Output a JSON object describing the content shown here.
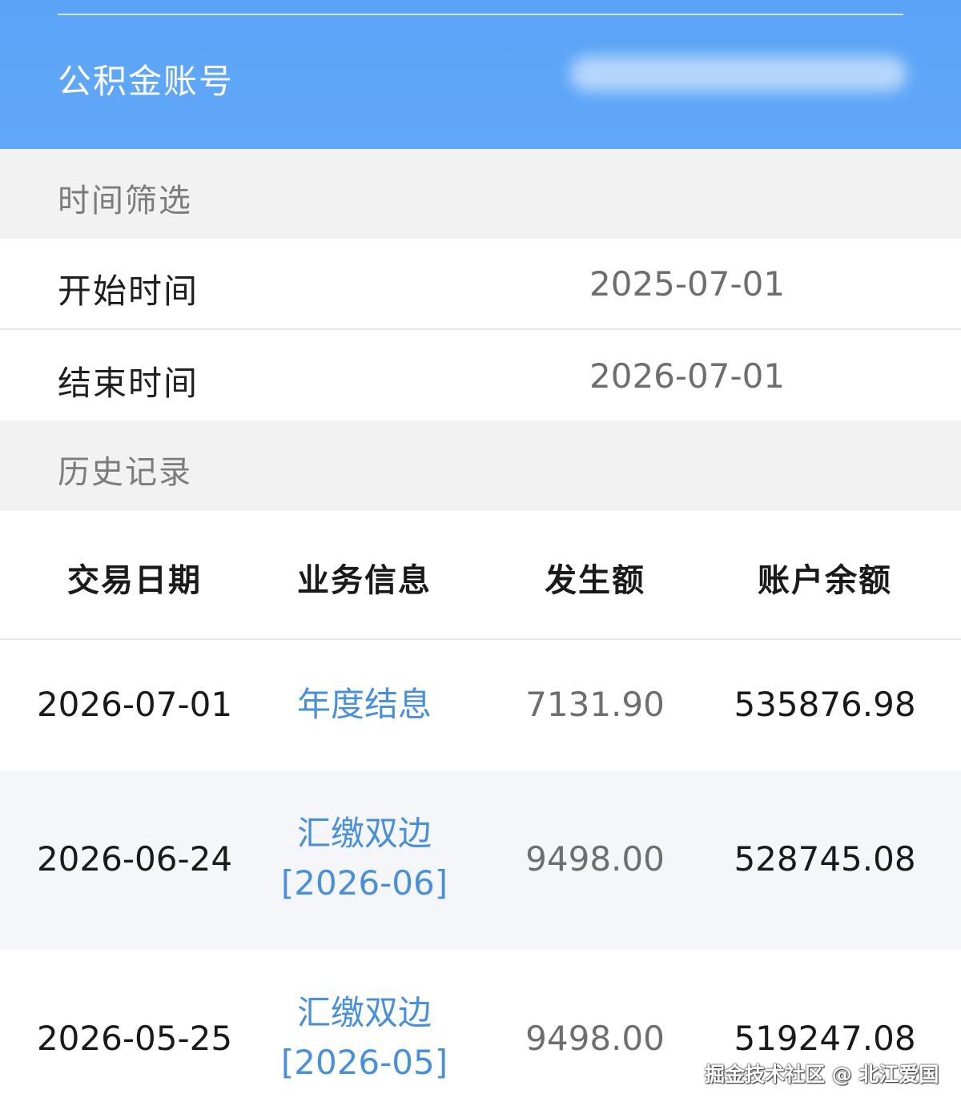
{
  "header": {
    "account_label": "公积金账号"
  },
  "filter_section": {
    "title": "时间筛选",
    "start_label": "开始时间",
    "start_value": "2025-07-01",
    "end_label": "结束时间",
    "end_value": "2026-07-01"
  },
  "history_section": {
    "title": "历史记录",
    "columns": [
      "交易日期",
      "业务信息",
      "发生额",
      "账户余额"
    ],
    "rows": [
      {
        "date": "2026-07-01",
        "info_line1": "年度结息",
        "info_line2": "",
        "amount": "7131.90",
        "balance": "535876.98"
      },
      {
        "date": "2026-06-24",
        "info_line1": "汇缴双边",
        "info_line2": "[2026-06]",
        "amount": "9498.00",
        "balance": "528745.08"
      },
      {
        "date": "2026-05-25",
        "info_line1": "汇缴双边",
        "info_line2": "[2026-05]",
        "amount": "9498.00",
        "balance": "519247.08"
      }
    ]
  },
  "watermark": "掘金技术社区 @ 北江爱国",
  "colors": {
    "header_bg": "#5aa3f7",
    "section_bg": "#f2f2f2",
    "alt_row_bg": "#f4f6fa",
    "link_text": "#4a90d8"
  }
}
